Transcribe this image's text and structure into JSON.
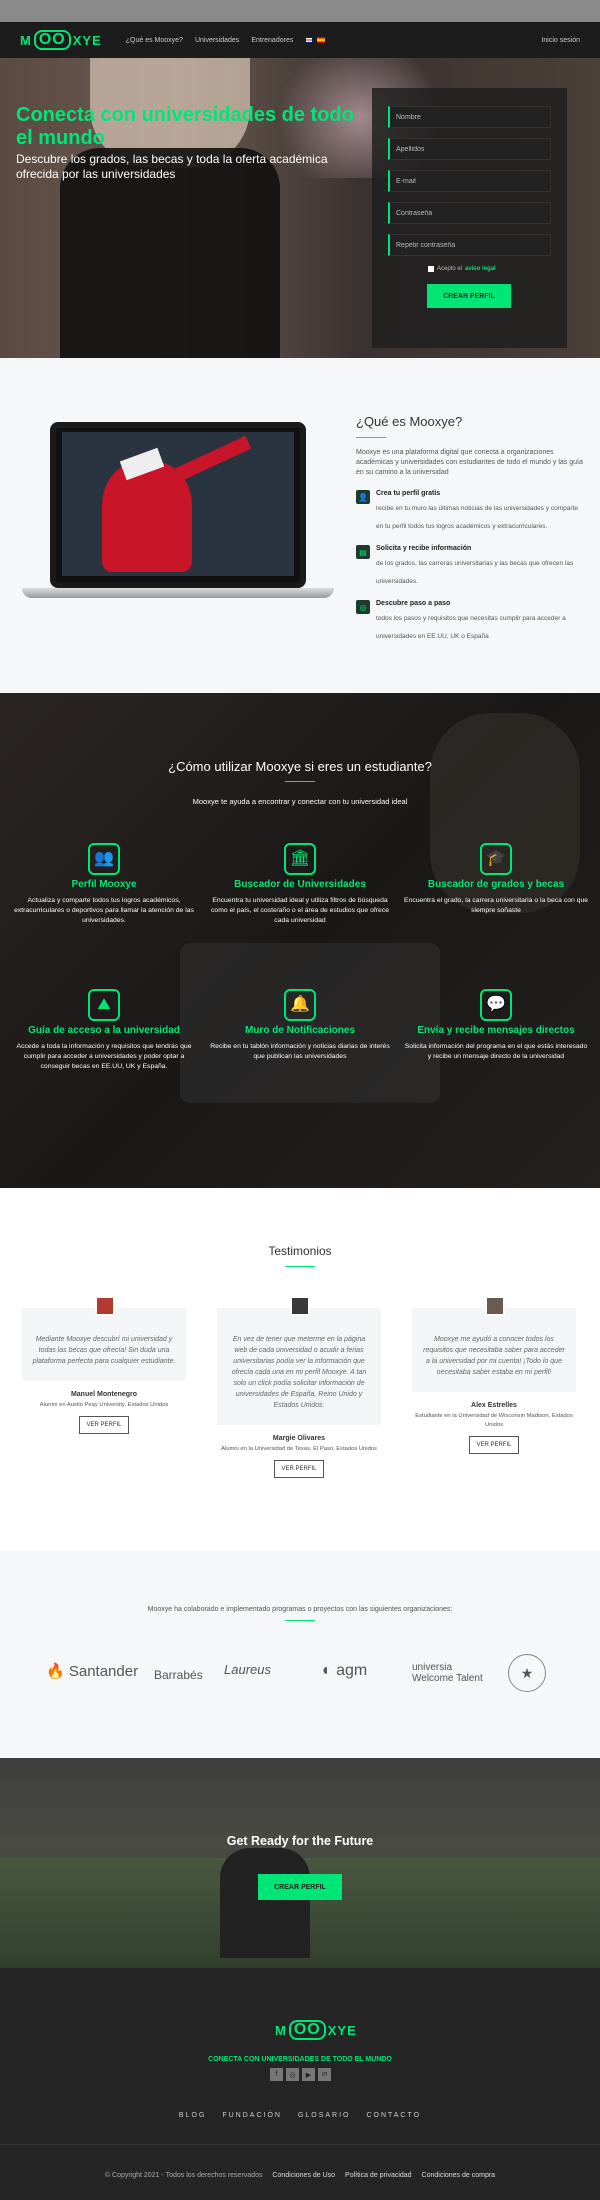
{
  "nav": {
    "logo": "MOOXYE",
    "logo_left": "M",
    "logo_mid": "OO",
    "logo_right": "XYE",
    "links": [
      "¿Qué es Mooxye?",
      "Universidades",
      "Entrenadores"
    ],
    "login": "Inicio sesión"
  },
  "hero": {
    "title": "Conecta con universidades de todo el mundo",
    "subtitle": "Descubre los grados, las becas y toda la oferta académica ofrecida por las universidades",
    "form": {
      "name_placeholder": "Nombre",
      "surname_placeholder": "Apellidos",
      "email_placeholder": "E-mail",
      "password_placeholder": "Contraseña",
      "repeat_password_placeholder": "Repetir contraseña",
      "terms_prefix": "Acepto el",
      "terms_link": "aviso legal",
      "submit": "CREAR PERFIL"
    }
  },
  "about": {
    "title": "¿Qué es Mooxye?",
    "description": "Mooxye es una plataforma digital que conecta a organizaciones académicas y universidades con estudiantes de todo el mundo y las guía en su camino a la universidad",
    "features": [
      {
        "title": "Crea tu perfil gratis",
        "text": "recibe en tu muro las últimas noticias de las universidades y comparte en tu perfil todos tus logros académicos y extracurriculares."
      },
      {
        "title": "Solicita y recibe información",
        "text": "de los grados, las carreras universitarias y las becas que ofrecen las universidades."
      },
      {
        "title": "Descubre paso a paso",
        "text": "todos los pasos y requisitos que necesitas cumplir para acceder a universidades en EE.UU, UK o España"
      }
    ]
  },
  "howto": {
    "title": "¿Cómo utilizar Mooxye si eres un estudiante?",
    "subtitle": "Mooxye te ayuda a encontrar y conectar con tu universidad ideal",
    "cards": [
      {
        "icon": "👥",
        "title": "Perfil Mooxye",
        "text": "Actualiza y comparte todos tus logros académicos, extracurriculares o deportivos para llamar la atención de las universidades."
      },
      {
        "icon": "🏛",
        "title": "Buscador de Universidades",
        "text": "Encuentra tu universidad ideal y utiliza filtros de búsqueda como el país, el coste/año o el área de estudios que ofrece cada universidad"
      },
      {
        "icon": "🎓",
        "title": "Buscador de grados y becas",
        "text": "Encuentra el grado, la carrera universitaria o la beca con que siempre soñaste"
      },
      {
        "icon": "⛰",
        "title": "Guía de acceso a la universidad",
        "text": "Accede a toda la información y requisitos que tendrás que cumplir para acceder a universidades y poder optar a conseguir becas en EE.UU, UK y España."
      },
      {
        "icon": "🔔",
        "title": "Muro de Notificaciones",
        "text": "Recibe en tu tablón información y noticias diarias de interés que publican las universidades"
      },
      {
        "icon": "💬",
        "title": "Envía y recibe mensajes directos",
        "text": "Solicita información del programa en el que estás interesado y recibe un mensaje directo de la universidad"
      }
    ]
  },
  "testimonials": {
    "title": "Testimonios",
    "items": [
      {
        "quote": "Mediante Mooxye descubrí mi universidad y todas las becas que ofrecía! Sin duda una plataforma perfecta para cualquier estudiante.",
        "name": "Manuel Montenegro",
        "sub": "Alumni en Austin Peay University, Estados Unidos",
        "button": "VER PERFIL",
        "avatar_color": "#b23a2e"
      },
      {
        "quote": "En vez de tener que meterme en la página web de cada universidad o acudir a ferias universitarias podía ver la información que ofrecía cada una en mi perfil Mooxye. A tan solo un click podía solicitar información de universidades de España, Reino Unido y Estados Unidos.",
        "name": "Margie Olivares",
        "sub": "Alumni en la Universidad de Texas, El Paso, Estados Unidos",
        "button": "VER PERFIL",
        "avatar_color": "#3a3a3a"
      },
      {
        "quote": "Mooxye me ayudó a conocer todos los requisitos que necesitaba saber para acceder a la universidad por mi cuenta! ¡Todo lo que necesitaba saber estaba en mi perfil!",
        "name": "Alex Estrelles",
        "sub": "Estudiante en la Universidad de Wisconsin Madison, Estados Unidos",
        "button": "VER PERFIL",
        "avatar_color": "#6a5a50"
      }
    ]
  },
  "partners": {
    "intro": "Mooxye ha colaborado e implementado programas o proyectos con las siguientes organizaciones:",
    "logos": [
      "Santander",
      "Barrabés",
      "Laureus",
      "agm",
      "university welcome talent",
      "seal"
    ],
    "labels": {
      "santander": "Santander",
      "barrabes": "Barrabés",
      "laureus": "Laureus",
      "agm": "agm",
      "uni_top": "universia",
      "uni_bottom": "Welcome Talent"
    }
  },
  "cta": {
    "title": "Get Ready for the Future",
    "button": "CREAR PERFIL"
  },
  "footer": {
    "tagline": "CONECTA CON UNIVERSIDADES DE TODO EL MUNDO",
    "social_icons": [
      "facebook-icon",
      "instagram-icon",
      "youtube-icon",
      "linkedin-icon"
    ],
    "nav": [
      "BLOG",
      "FUNDACIÓN",
      "GLOSARIO",
      "CONTACTO"
    ],
    "copyright": "© Copyright 2021 - Todos los derechos reservados",
    "legal_links": [
      "Condiciones de Uso",
      "Política de privacidad",
      "Condiciones de compra"
    ]
  },
  "colors": {
    "brand_green": "#00e676",
    "dark": "#1c1c1c",
    "footer": "#252525"
  }
}
